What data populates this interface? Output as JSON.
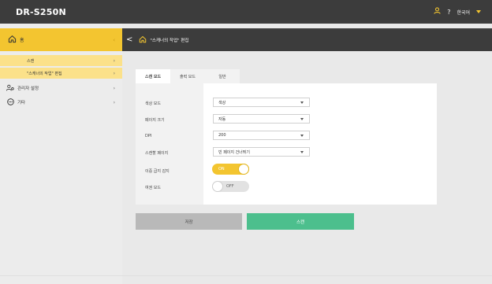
{
  "app": {
    "brand": "DR-S250N"
  },
  "topbar": {
    "help": "?",
    "language": "한국어"
  },
  "sidebar": {
    "home_label": "홈",
    "items": [
      {
        "label": "스캔"
      },
      {
        "label": "\"스캐너의 작업\" 편집"
      },
      {
        "label": "관리자 설정"
      },
      {
        "label": "기타"
      }
    ]
  },
  "header": {
    "back": "<",
    "title": "\"스캐너의 작업\" 편집"
  },
  "tabs": [
    {
      "label": "스캔 모드",
      "active": true
    },
    {
      "label": "출력 모드",
      "active": false
    },
    {
      "label": "일반",
      "active": false
    }
  ],
  "settings": {
    "color_mode": {
      "label": "색상 모드",
      "value": "색상"
    },
    "page_size": {
      "label": "페이지 크기",
      "value": "자동"
    },
    "dpi": {
      "label": "DPI",
      "value": "200"
    },
    "scan_side": {
      "label": "스캔할 페이지",
      "value": "빈 페이지 건너뛰기"
    },
    "double_feed": {
      "label": "이중 급지 감지",
      "state": "ON"
    },
    "passport": {
      "label": "여권 모드",
      "state": "OFF"
    }
  },
  "actions": {
    "save": "저장",
    "scan": "스캔"
  },
  "colors": {
    "accent": "#f3c530",
    "dark": "#3c3c3c",
    "scan": "#4cbf8d"
  }
}
